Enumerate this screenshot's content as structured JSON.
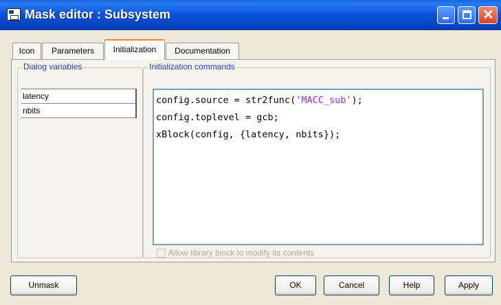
{
  "window": {
    "title": "Mask editor : Subsystem"
  },
  "tabs": [
    {
      "label": "Icon"
    },
    {
      "label": "Parameters"
    },
    {
      "label": "Initialization"
    },
    {
      "label": "Documentation"
    }
  ],
  "active_tab": "Initialization",
  "dialog_variables": {
    "legend": "Dialog variables",
    "items": [
      "latency",
      "nbits"
    ]
  },
  "init_commands": {
    "legend": "Initialization commands",
    "line1_pre": "config.source = str2func(",
    "line1_str": "'MACC_sub'",
    "line1_post": ");",
    "line2": "config.toplevel = gcb;",
    "line3": "xBlock(config, {latency, nbits});"
  },
  "allow_modify": {
    "label": "Allow library block to modify its contents",
    "checked": false,
    "enabled": false
  },
  "buttons": {
    "unmask": "Unmask",
    "ok": "OK",
    "cancel": "Cancel",
    "help": "Help",
    "apply": "Apply"
  }
}
